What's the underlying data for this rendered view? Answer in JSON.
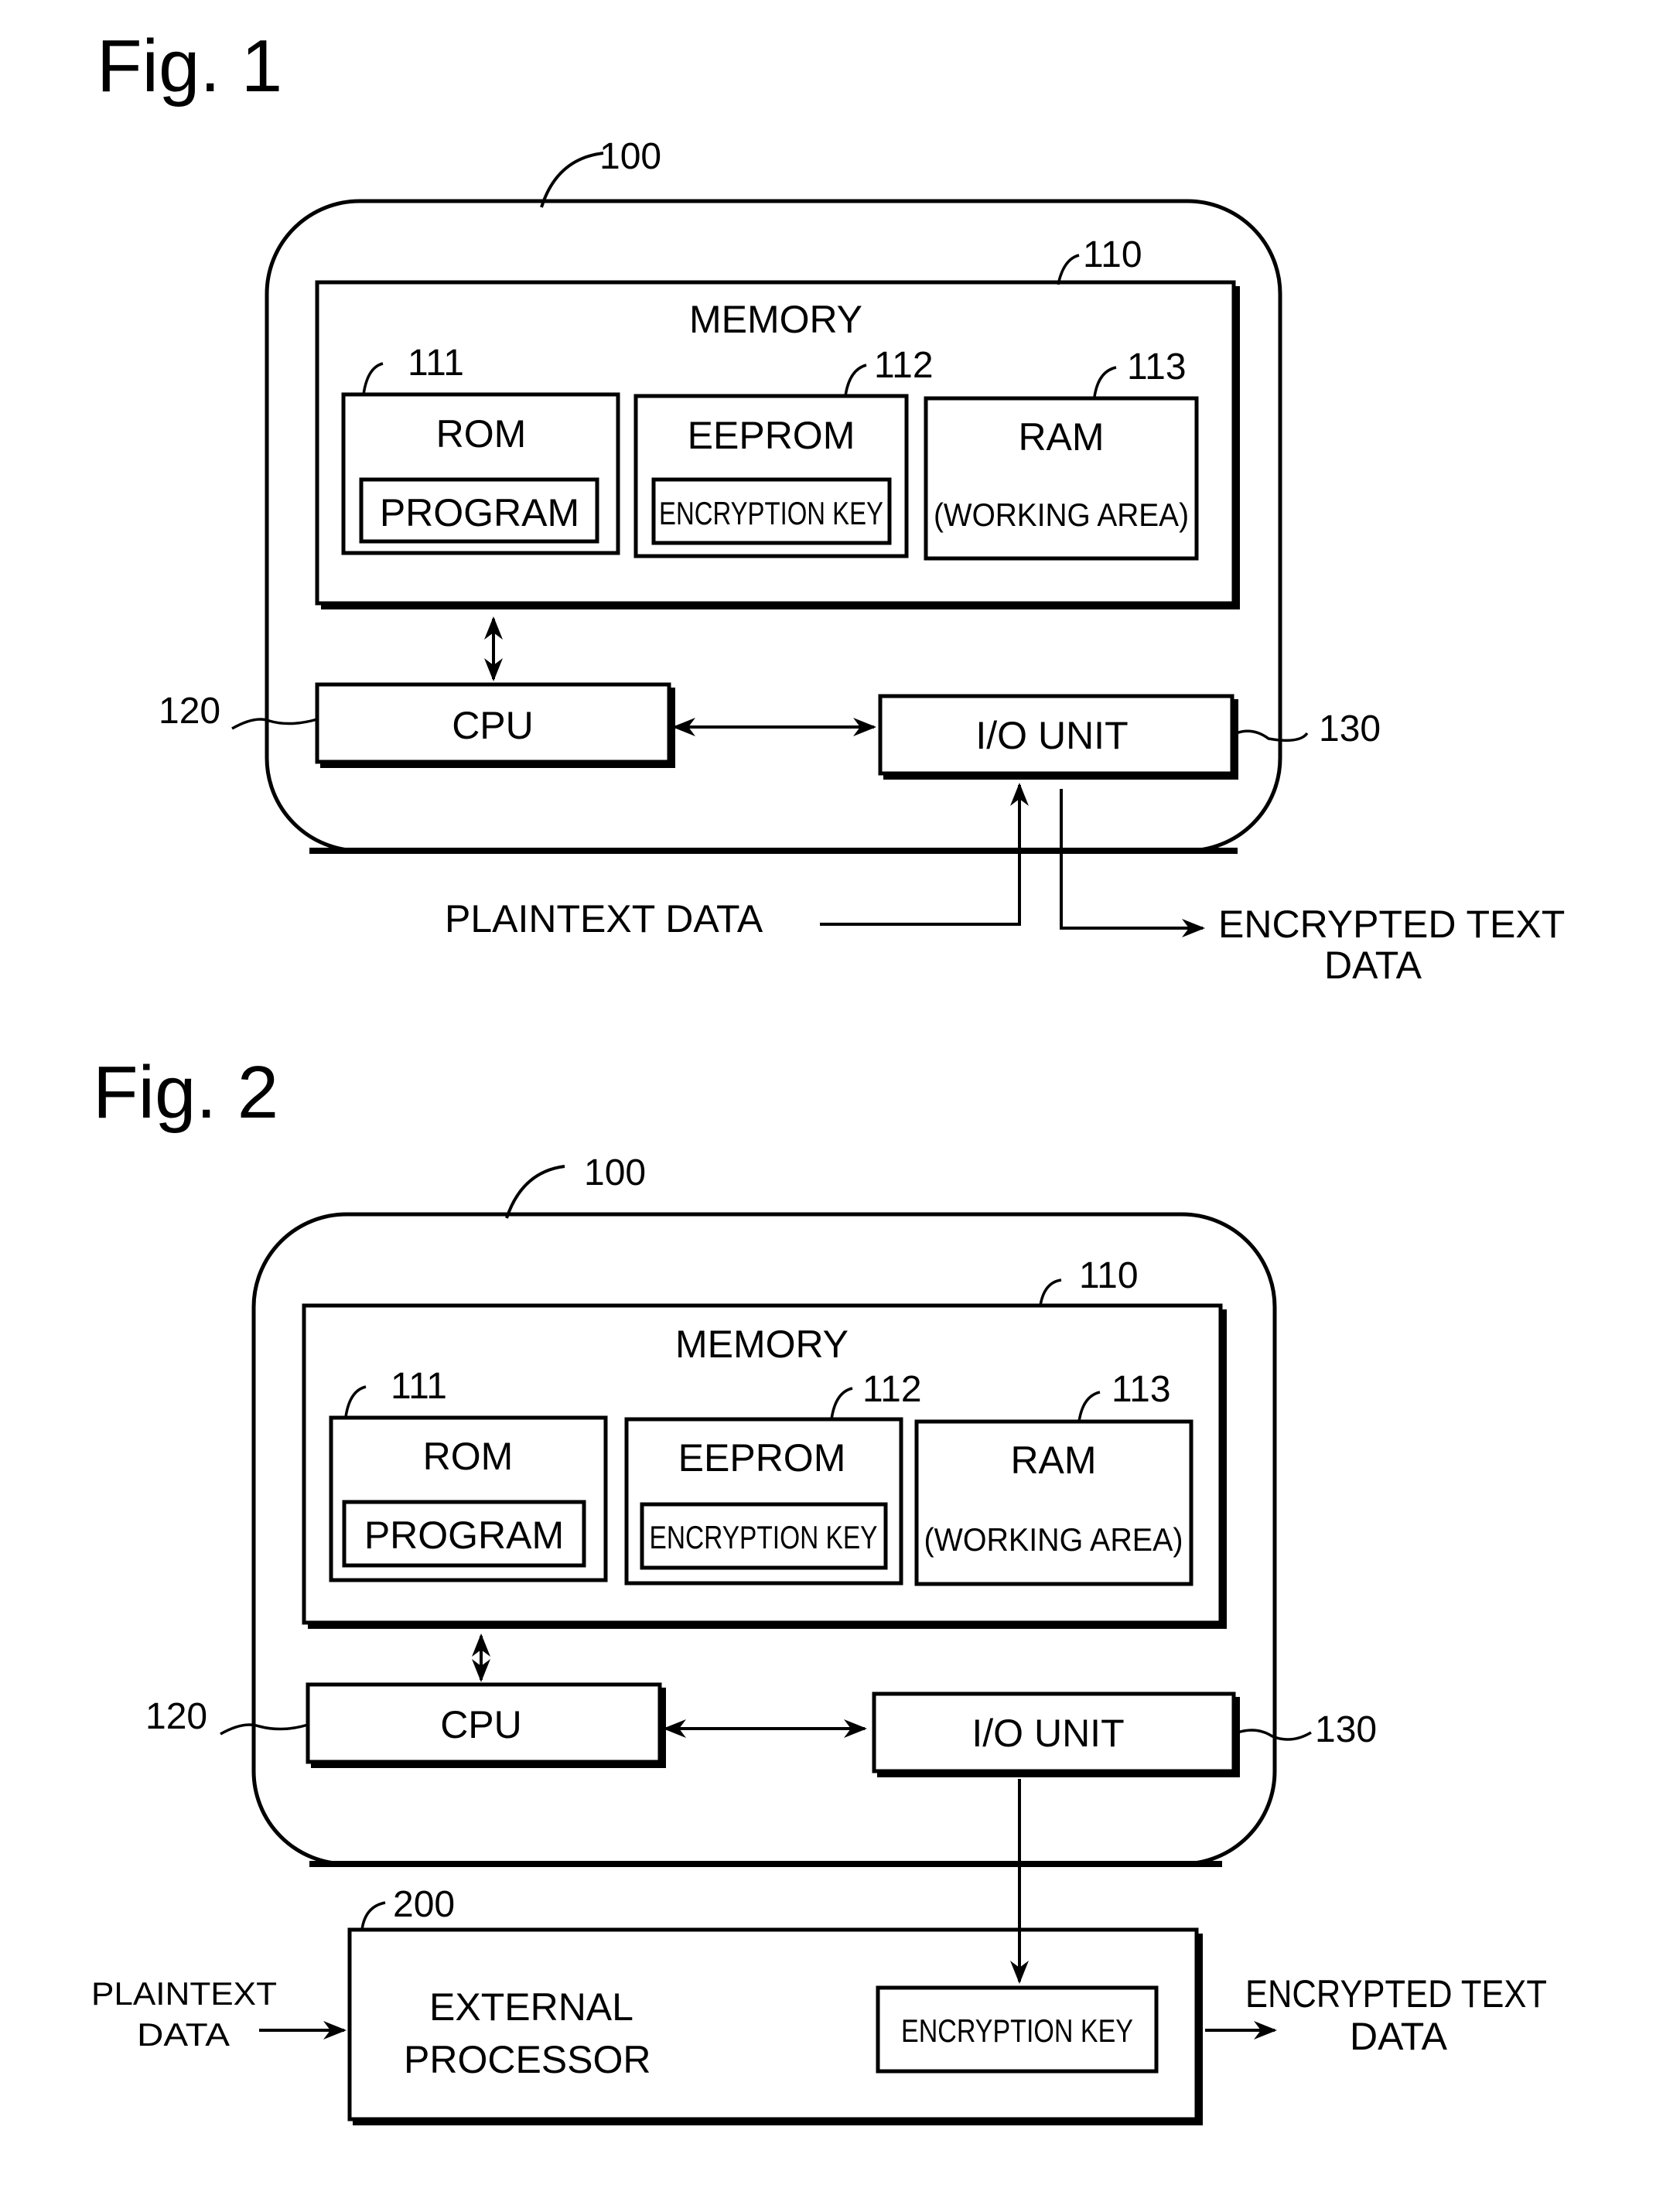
{
  "figures": [
    {
      "title": "Fig. 1",
      "device_ref": "100",
      "memory": {
        "ref": "110",
        "label": "MEMORY"
      },
      "rom": {
        "ref": "111",
        "label": "ROM",
        "inner": "PROGRAM"
      },
      "eeprom": {
        "ref": "112",
        "label": "EEPROM",
        "inner": "ENCRYPTION KEY"
      },
      "ram": {
        "ref": "113",
        "label": "RAM",
        "inner": "(WORKING AREA)"
      },
      "cpu": {
        "ref": "120",
        "label": "CPU"
      },
      "io": {
        "ref": "130",
        "label": "I/O UNIT"
      },
      "input_label": "PLAINTEXT DATA",
      "output_label_line1": "ENCRYPTED TEXT",
      "output_label_line2": "DATA"
    },
    {
      "title": "Fig. 2",
      "device_ref": "100",
      "memory": {
        "ref": "110",
        "label": "MEMORY"
      },
      "rom": {
        "ref": "111",
        "label": "ROM",
        "inner": "PROGRAM"
      },
      "eeprom": {
        "ref": "112",
        "label": "EEPROM",
        "inner": "ENCRYPTION KEY"
      },
      "ram": {
        "ref": "113",
        "label": "RAM",
        "inner": "(WORKING AREA)"
      },
      "cpu": {
        "ref": "120",
        "label": "CPU"
      },
      "io": {
        "ref": "130",
        "label": "I/O UNIT"
      },
      "external": {
        "ref": "200",
        "label_line1": "EXTERNAL",
        "label_line2": "PROCESSOR",
        "inner": "ENCRYPTION KEY"
      },
      "input_label_line1": "PLAINTEXT",
      "input_label_line2": "DATA",
      "output_label_line1": "ENCRYPTED TEXT",
      "output_label_line2": "DATA"
    }
  ]
}
